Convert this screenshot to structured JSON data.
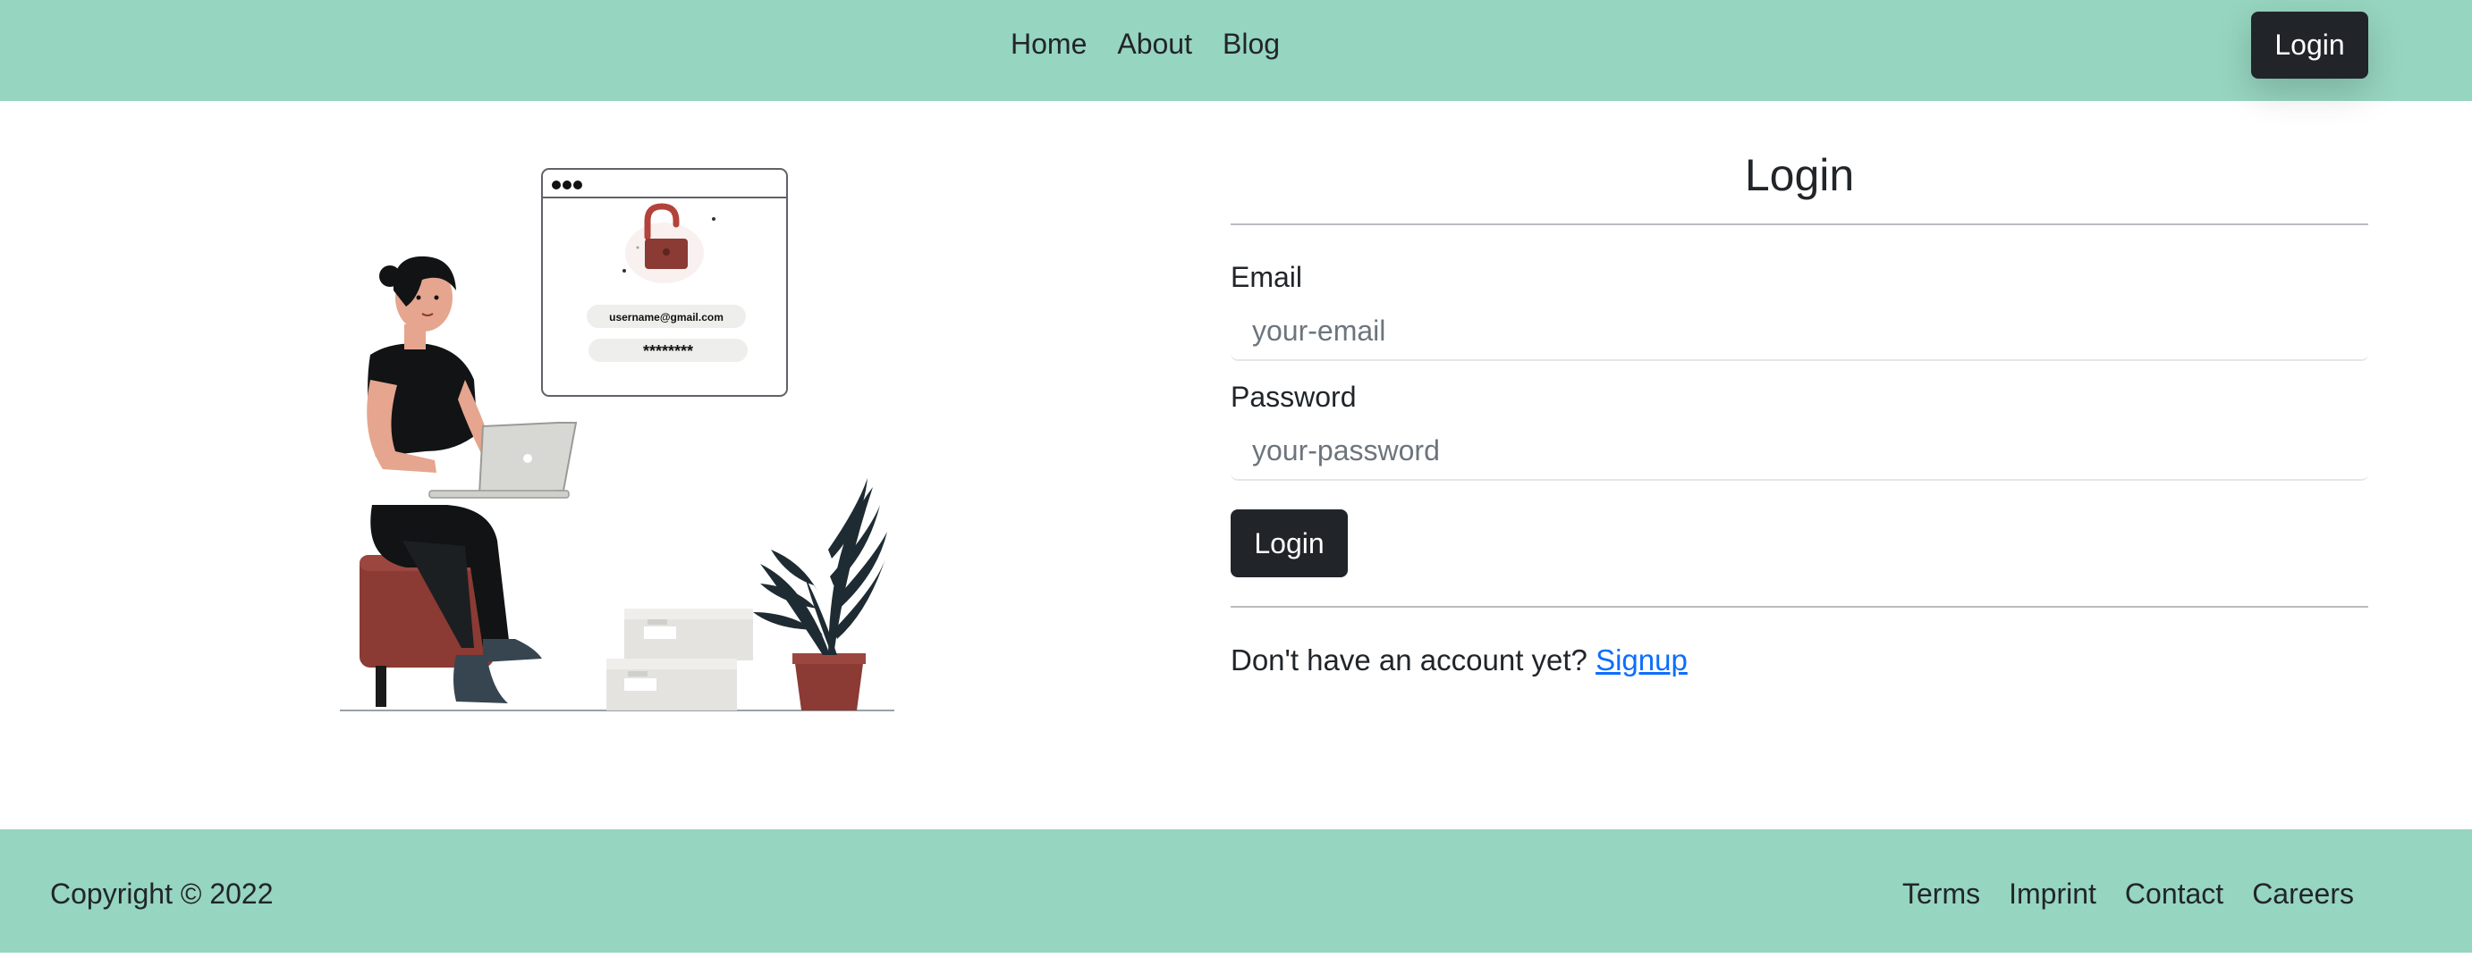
{
  "header": {
    "nav": [
      "Home",
      "About",
      "Blog"
    ],
    "login_label": "Login"
  },
  "illustration": {
    "email_text": "username@gmail.com",
    "password_text": "********"
  },
  "form": {
    "title": "Login",
    "email_label": "Email",
    "email_placeholder": "your-email",
    "password_label": "Password",
    "password_placeholder": "your-password",
    "submit_label": "Login",
    "signup_prompt": "Don't have an account yet?",
    "signup_link": "Signup"
  },
  "footer": {
    "copyright": "Copyright © 2022",
    "links": [
      "Terms",
      "Imprint",
      "Contact",
      "Careers"
    ]
  },
  "colors": {
    "brand_green": "#96d5c0",
    "dark_button": "#212529",
    "link_blue": "#0d6efd",
    "accent_red": "#8b3a34"
  }
}
